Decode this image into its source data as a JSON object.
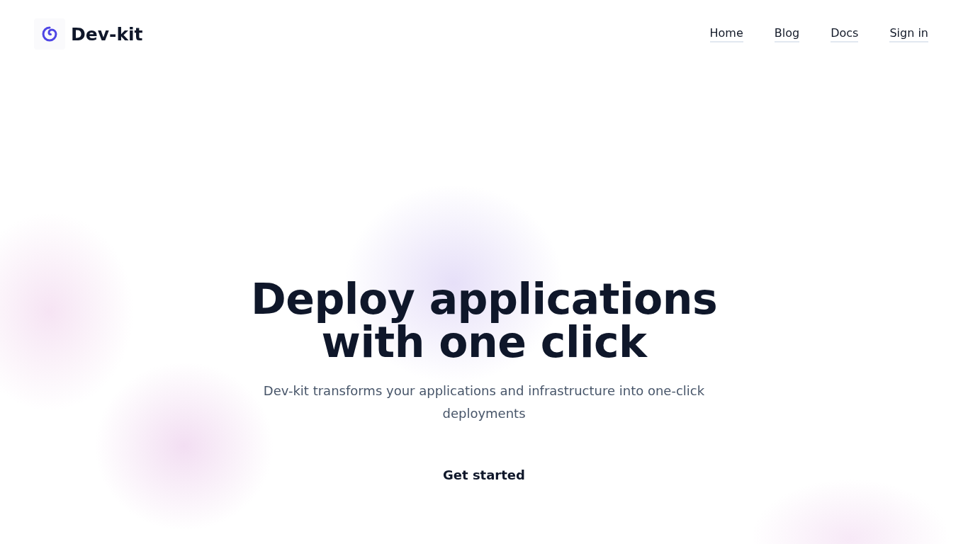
{
  "brand": {
    "name": "Dev-kit"
  },
  "nav": [
    {
      "label": "Home"
    },
    {
      "label": "Blog"
    },
    {
      "label": "Docs"
    },
    {
      "label": "Sign in"
    }
  ],
  "hero": {
    "title_lines": [
      "Deploy applications",
      "with one click"
    ],
    "subtitle": "Dev-kit transforms your applications and infrastructure into one-click deployments",
    "cta": "Get started"
  }
}
